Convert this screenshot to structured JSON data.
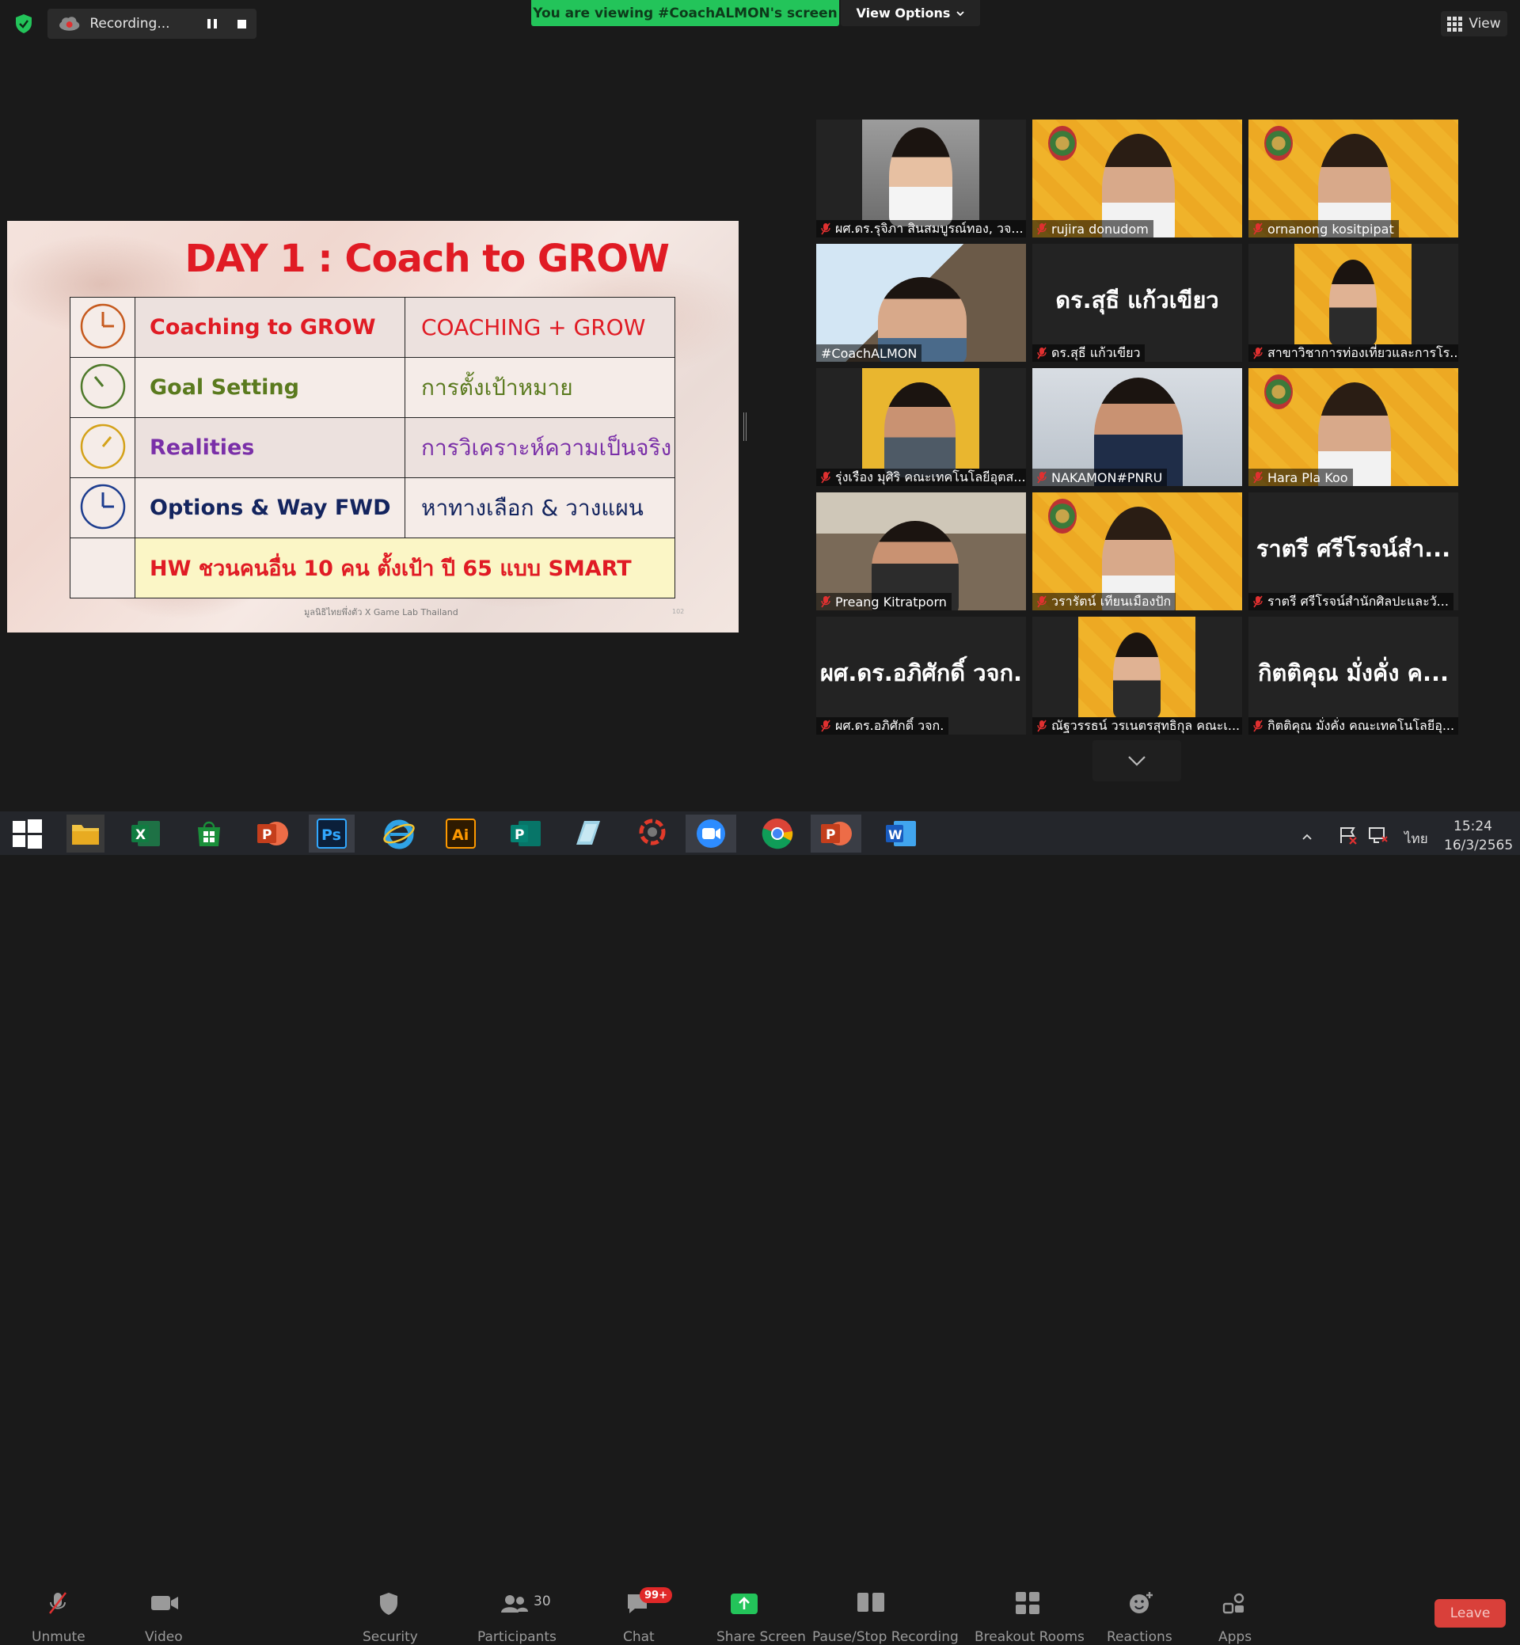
{
  "recording": {
    "label": "Recording..."
  },
  "banner": {
    "viewing": "You are viewing #CoachALMON's screen",
    "view_options": "View Options"
  },
  "view_button": {
    "label": "View"
  },
  "slide": {
    "title": "DAY 1 : Coach to GROW",
    "rows": [
      {
        "en": "Coaching to GROW",
        "th": "COACHING + GROW",
        "en_color": "#e01b24",
        "th_color": "#e01b24",
        "clock_color": "#c65a1e"
      },
      {
        "en": "Goal Setting",
        "th": "การตั้งเป้าหมาย",
        "en_color": "#5a7a1e",
        "th_color": "#5a7a1e",
        "clock_color": "#4f7a2b"
      },
      {
        "en": "Realities",
        "th": "การวิเคราะห์ความเป็นจริง",
        "en_color": "#7a2fa8",
        "th_color": "#7a2fa8",
        "clock_color": "#d4a21a"
      },
      {
        "en": "Options & Way FWD",
        "th": "หาทางเลือก & วางแผน",
        "en_color": "#13245e",
        "th_color": "#13245e",
        "clock_color": "#1d3d8f"
      }
    ],
    "hw": "HW ชวนคนอื่น 10 คน ตั้งเป้า ปี 65 แบบ SMART",
    "footer": "มูลนิธิไทยพึ่งตัว X Game Lab Thailand",
    "page": "102"
  },
  "participants": [
    {
      "name": "ผศ.ดร.รุจิภา สินสมบูรณ์ทอง, วจ...",
      "kind": "cam"
    },
    {
      "name": "rujira donudom",
      "kind": "poster"
    },
    {
      "name": "ornanong kositpipat",
      "kind": "poster"
    },
    {
      "name": "#CoachALMON",
      "kind": "share"
    },
    {
      "name": "ดร.สุธี แก้วเขียว",
      "big": "ดร.สุธี แก้วเขียว",
      "kind": "text"
    },
    {
      "name": "สาขาวิชาการท่องเที่ยวและการโร...",
      "kind": "poster-small"
    },
    {
      "name": "รุ่งเรือง มุศิริ คณะเทคโนโลยีอุตส...",
      "kind": "cam-yellow"
    },
    {
      "name": "NAKAMON#PNRU",
      "kind": "cam-blue"
    },
    {
      "name": "Hara Pla Koo",
      "kind": "poster"
    },
    {
      "name": "Preang Kitratporn",
      "kind": "cam-office"
    },
    {
      "name": "วรารัตน์ เทียนเมืองปัก",
      "kind": "poster"
    },
    {
      "name": "ราตรี  ศรีโรจน์สำนักศิลปะและวั...",
      "big": "ราตรี  ศรีโรจน์สำ...",
      "kind": "text"
    },
    {
      "name": "ผศ.ดร.อภิศักดิ์ วจก.",
      "big": "ผศ.ดร.อภิศักดิ์ วจก.",
      "kind": "text"
    },
    {
      "name": "ณัฐวรรธน์ วรเนตรสุทธิกุล คณะเ...",
      "kind": "poster-small"
    },
    {
      "name": "กิตติคุณ  มั่งคั่ง คณะเทคโนโลยีอุ...",
      "big": "กิตติคุณ  มั่งคั่ง ค...",
      "kind": "text"
    }
  ],
  "toolbar": {
    "unmute": "Unmute",
    "video": "Video",
    "security": "Security",
    "participants": "Participants",
    "participants_count": "30",
    "chat": "Chat",
    "chat_badge": "99+",
    "share": "Share Screen",
    "pause": "Pause/Stop Recording",
    "breakout": "Breakout Rooms",
    "reactions": "Reactions",
    "apps": "Apps",
    "leave": "Leave"
  },
  "tray": {
    "time": "15:24",
    "date": "16/3/2565",
    "lang": "ไทย"
  },
  "colors": {
    "zoom_green": "#23c45a",
    "active_speaker": "#f4e41f",
    "leave_red": "#e02828"
  }
}
